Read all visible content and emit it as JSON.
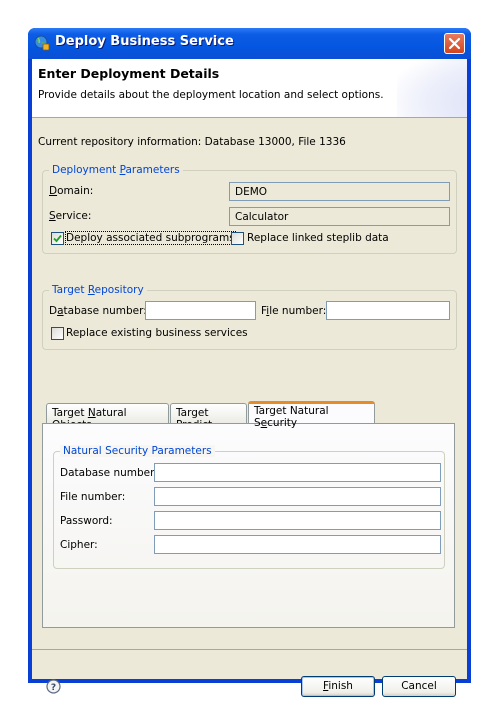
{
  "window": {
    "title": "Deploy Business Service",
    "title_icon": "globe-service-icon",
    "close_icon": "close-icon"
  },
  "header": {
    "title": "Enter Deployment Details",
    "description": "Provide details about the deployment location and select options."
  },
  "repository_info": "Current repository information: Database 13000, File 1336",
  "deployment_parameters": {
    "legend_pre": "Deployment ",
    "legend_mn": "P",
    "legend_post": "arameters",
    "domain_label_mn": "D",
    "domain_label_rest": "omain:",
    "domain_value": "DEMO",
    "service_label_mn": "S",
    "service_label_rest": "ervice:",
    "service_value": "Calculator",
    "deploy_subprograms_label": "Deploy associated subprograms",
    "deploy_subprograms_checked": true,
    "replace_steplib_label": "Replace linked steplib data",
    "replace_steplib_checked": false
  },
  "target_repository": {
    "legend_pre": "Target ",
    "legend_mn": "R",
    "legend_post": "epository",
    "database_label_pre": "D",
    "database_label_mn": "a",
    "database_label_post": "tabase number:",
    "database_value": "",
    "file_label_pre": "F",
    "file_label_mn": "i",
    "file_label_post": "le number:",
    "file_value": "",
    "replace_services_label": "Replace existing business services",
    "replace_services_checked": false
  },
  "tabs": [
    {
      "pre": "Target ",
      "mn": "N",
      "post": "atural Objects",
      "active": false
    },
    {
      "pre": "Target ",
      "mn": "P",
      "post": "redict",
      "active": false
    },
    {
      "pre": "Target Natural S",
      "mn": "e",
      "post": "curity",
      "active": true
    }
  ],
  "security_parameters": {
    "legend": "Natural Security Parameters",
    "fields": [
      {
        "label": "Database number:",
        "value": ""
      },
      {
        "label": "File number:",
        "value": ""
      },
      {
        "label": "Password:",
        "value": ""
      },
      {
        "label": "Cipher:",
        "value": ""
      }
    ]
  },
  "footer": {
    "help_icon": "help-icon",
    "finish_mn": "F",
    "finish_rest": "inish",
    "cancel_label": "Cancel"
  },
  "colors": {
    "titlebar": "#0556e0",
    "dialog_bg": "#ece9d8",
    "group_legend": "#0046d5",
    "active_tab_accent": "#e68b2c"
  }
}
